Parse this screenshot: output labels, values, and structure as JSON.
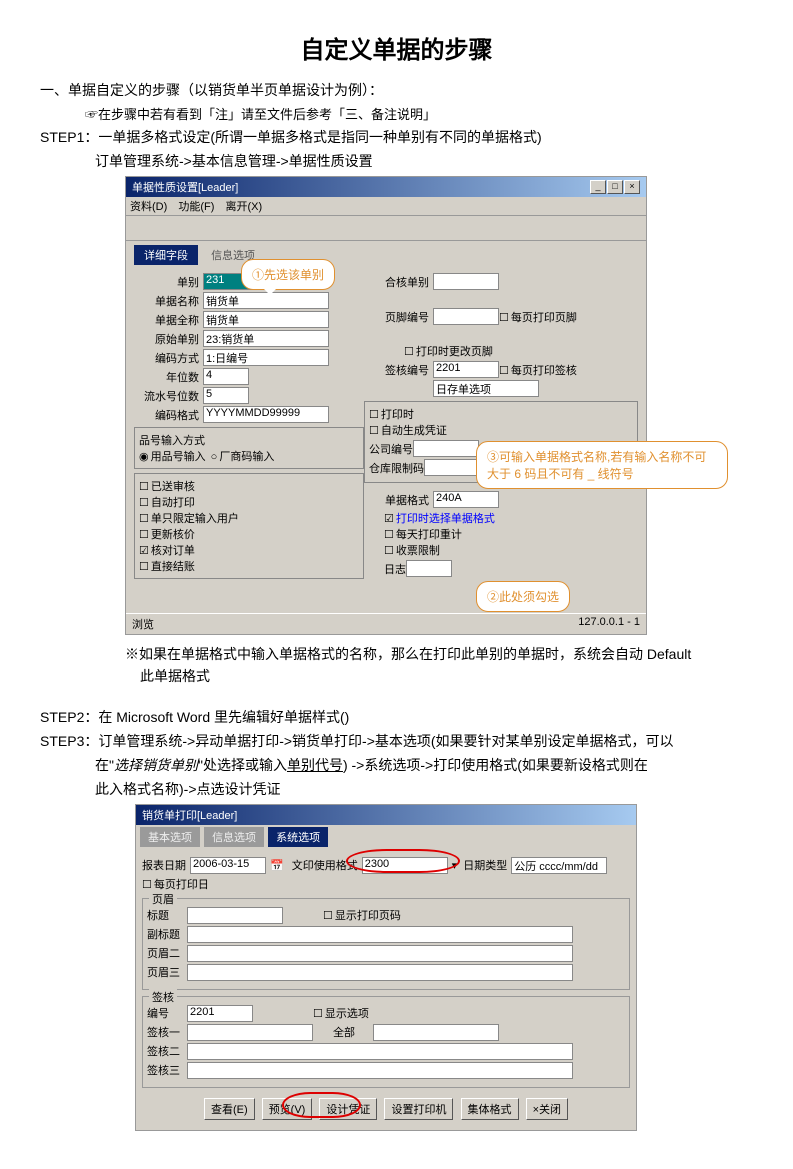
{
  "title": "自定义单据的步骤",
  "s1_head": "一、单据自定义的步骤（以销货单半页单据设计为例）：",
  "s1_note": "☞在步骤中若有看到「注」请至文件后参考「三、备注说明」",
  "step1_l1": "STEP1：一单据多格式设定(所谓一单据多格式是指同一种单别有不同的单据格式)",
  "step1_l2": "订单管理系统->基本信息管理->单据性质设置",
  "win1": {
    "title": "单据性质设置[Leader]",
    "menu": [
      "资料(D)",
      "功能(F)",
      "离开(X)"
    ],
    "tab1": "详细字段",
    "tab2": "信息选项",
    "fields": {
      "f_danbie": "单别",
      "v_danbie": "231",
      "f_danju": "单据名称",
      "v_danju": "销货单",
      "f_fanti": "单据全称",
      "v_fanti": "销货单",
      "f_yuanbie": "原始单别",
      "v_yuanbie": "23:销货单",
      "f_bianma": "编码方式",
      "v_bianma": "1:日编号",
      "f_nian": "年位数",
      "v_nian": "4",
      "f_liushui": "流水号位数",
      "v_liushui": "5",
      "f_bianma2": "编码格式",
      "v_bianma2": "YYYYMMDD99999",
      "f_hedu": "合核单别",
      "v_hedu": "",
      "f_yejiao": "页脚编号",
      "v_yejiao": "",
      "f_qianhe": "签核编号",
      "v_qianhe": "2201",
      "f_danju_gs": "单据格式",
      "v_danju_gs": "240A",
      "cb_meiyeyj": "每页打印页脚",
      "cb_dayin_gf": "打印时更改页脚",
      "cb_meiyeqh": "每页打印签核",
      "cb_dayin_xj": "打印时选择单据格式",
      "cb_meitian": "每天打印重计",
      "cb_piaojv": "收票限制",
      "cb_rizhi": "日志",
      "grp_input": "品号输入方式",
      "rb1": "用品号输入",
      "rb2": "厂商码输入",
      "cb_a1": "已送审核",
      "cb_a2": "自动打印",
      "cb_a3": "单只限定输入用户",
      "cb_a4": "更新核价",
      "cb_a5": "核对订单",
      "cb_a6": "直接结账",
      "cb_b1": "打印时",
      "cb_b2": "自动生成凭证",
      "lbl_gs": "公司编号",
      "lbl_ck": "仓库限制码"
    },
    "call1": "①先选该单别",
    "call2": "②此处须勾选",
    "call3": "③可输入单据格式名称,若有输入名称不可大于 6 码且不可有 _ 线符号",
    "status_l": "浏览",
    "status_r": "127.0.0.1 - 1"
  },
  "after1_l1": "※如果在单据格式中输入单据格式的名称，那么在打印此单别的单据时，系统会自动 Default",
  "after1_l2": "此单据格式",
  "step2": "STEP2：在 Microsoft Word 里先编辑好单据样式()",
  "step3_l1": "STEP3：订单管理系统->异动单据打印->销货单打印->基本选项(如果要针对某单别设定单据格式，可以",
  "step3_l2": "在\"",
  "step3_em": "选择销货单别",
  "step3_l2b": "\"处选择或输入",
  "step3_u": "单别代号",
  "step3_l2c": ") ->系统选项->打印使用格式(如果要新设格式则在",
  "step3_l3": "此入格式名称)->点选设计凭证",
  "win2": {
    "title": "销货单打印[Leader]",
    "tabs": [
      "基本选项",
      "信息选项",
      "系统选项"
    ],
    "f_date": "报表日期",
    "v_date": "2006-03-15",
    "f_fmt": "文印使用格式",
    "v_fmt": "2300",
    "f_dtype": "日期类型",
    "v_dtype": "公历 cccc/mm/dd",
    "cb_mei": "每页打印日",
    "grp_ye": "页眉",
    "f_biaoti": "标题",
    "v_biaoti": "",
    "cb_xianshi": "显示打印页码",
    "f_fubiao": "副标题",
    "f_ye2": "页眉二",
    "f_ye3": "页眉三",
    "grp_qh": "签核",
    "f_bianhao": "编号",
    "v_bianhao": "2201",
    "cb_xs2": "显示选项",
    "f_qh1": "签核一",
    "f_qh2": "签核二",
    "f_qh3": "签核三",
    "f_jb": "全部",
    "btns": [
      "查看(E)",
      "预览(V)",
      "设计凭证",
      "设置打印机",
      "集体格式",
      "×关闭"
    ]
  }
}
